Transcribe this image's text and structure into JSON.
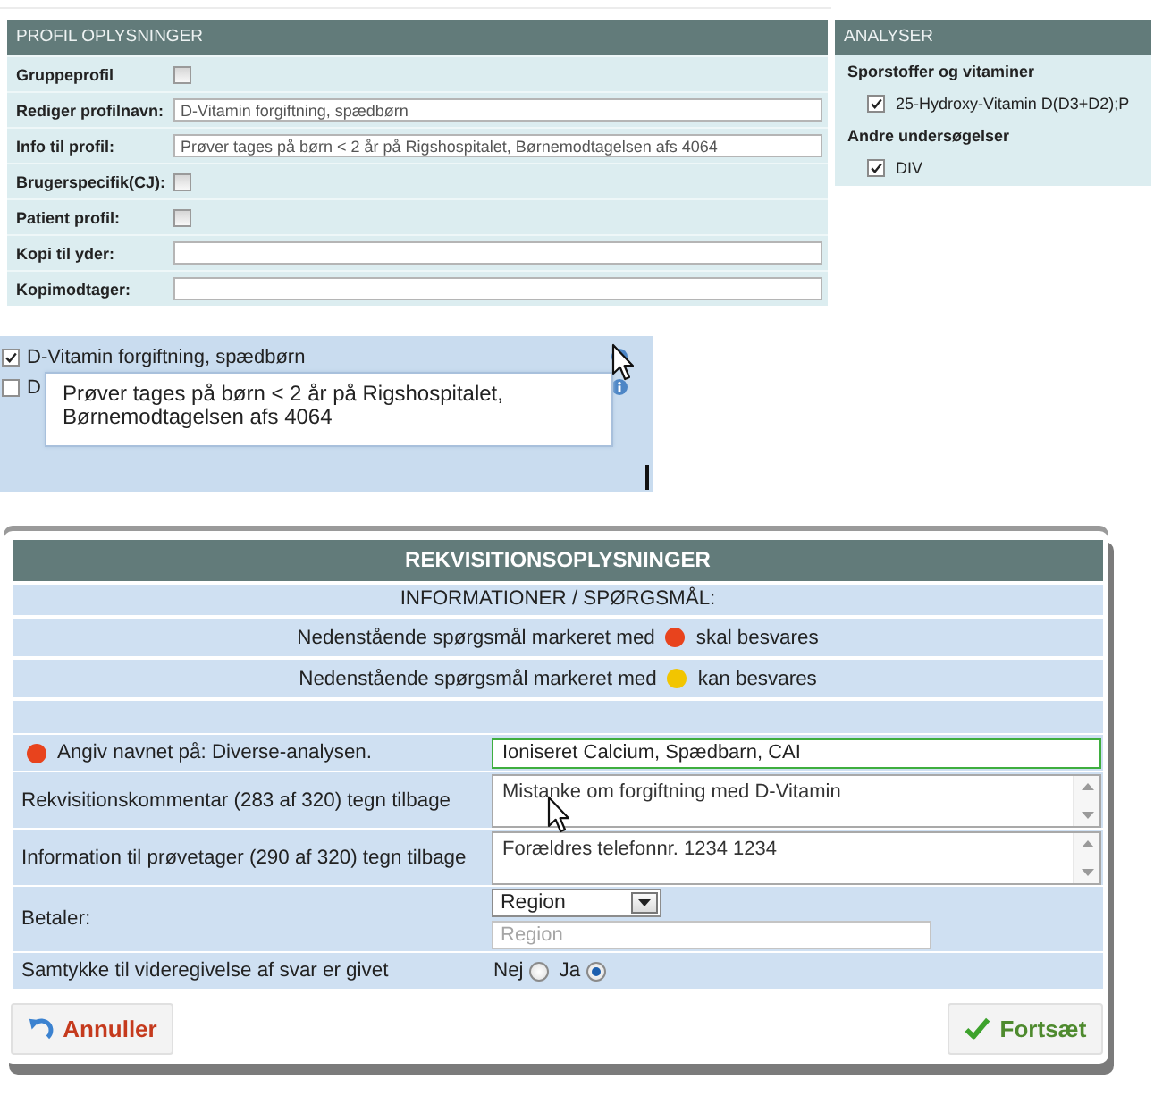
{
  "profile_panel": {
    "title": "PROFIL OPLYSNINGER",
    "rows": [
      {
        "kind": "checkbox",
        "label": "Gruppeprofil",
        "checked": false
      },
      {
        "kind": "text",
        "label": "Rediger profilnavn:",
        "value": "D-Vitamin forgiftning, spædbørn"
      },
      {
        "kind": "text",
        "label": "Info til profil:",
        "value": "Prøver tages på børn < 2 år på Rigshospitalet, Børnemodtagelsen afs 4064"
      },
      {
        "kind": "checkbox",
        "label": "Brugerspecifik(CJ):",
        "checked": false
      },
      {
        "kind": "checkbox",
        "label": "Patient profil:",
        "checked": false
      },
      {
        "kind": "text",
        "label": "Kopi til yder:"
      },
      {
        "kind": "text",
        "label": "Kopimodtager:"
      }
    ]
  },
  "analyses_panel": {
    "title": "ANALYSER",
    "groups": [
      {
        "name": "Sporstoffer og vitaminer",
        "items": [
          {
            "label": "25-Hydroxy-Vitamin D(D3+D2);P",
            "checked": true
          }
        ]
      },
      {
        "name": "Andre undersøgelser",
        "items": [
          {
            "label": "DIV",
            "checked": true
          }
        ]
      }
    ]
  },
  "profile_list": {
    "items": [
      {
        "label": "D-Vitamin forgiftning, spædbørn",
        "checked": true
      },
      {
        "label": "D",
        "checked": false
      }
    ],
    "tooltip": "Prøver tages på børn < 2 år på Rigshospitalet, Børnemodtagelsen afs 4064"
  },
  "dialog": {
    "title": "REKVISITIONSOPLYSNINGER",
    "subtitle": "INFORMATIONER / SPØRGSMÅL:",
    "legend": [
      {
        "text": "Nedenstående spørgsmål markeret med",
        "note": "skal besvares",
        "color": "#e8431d"
      },
      {
        "text": "Nedenstående spørgsmål markeret med",
        "note": "kan besvares",
        "color": "#f2c500"
      }
    ],
    "fields": [
      {
        "kind": "text",
        "label": "Angiv navnet på: Diverse-analysen.",
        "required": true,
        "focused": true,
        "value": "Ioniseret Calcium, Spædbarn, CAI"
      },
      {
        "kind": "textarea",
        "label": "Rekvisitionskommentar (283 af 320) tegn tilbage",
        "required": false,
        "focused": false,
        "value": "Mistanke om forgiftning med D-Vitamin"
      },
      {
        "kind": "textarea",
        "label": "Information til prøvetager (290 af 320) tegn tilbage",
        "required": false,
        "focused": false,
        "value": "Forældres telefonnr. 1234 1234"
      },
      {
        "kind": "select",
        "label": "Betaler:",
        "required": false,
        "value": "Region",
        "placeholder": "Region"
      },
      {
        "kind": "radio",
        "label": "Samtykke til videregivelse af svar er givet",
        "required": false,
        "options": [
          {
            "label": "Nej",
            "selected": false
          },
          {
            "label": "Ja",
            "selected": true
          }
        ]
      }
    ],
    "buttons": [
      {
        "kind": "cancel",
        "label": "Annuller"
      },
      {
        "kind": "confirm",
        "label": "Fortsæt"
      }
    ]
  }
}
